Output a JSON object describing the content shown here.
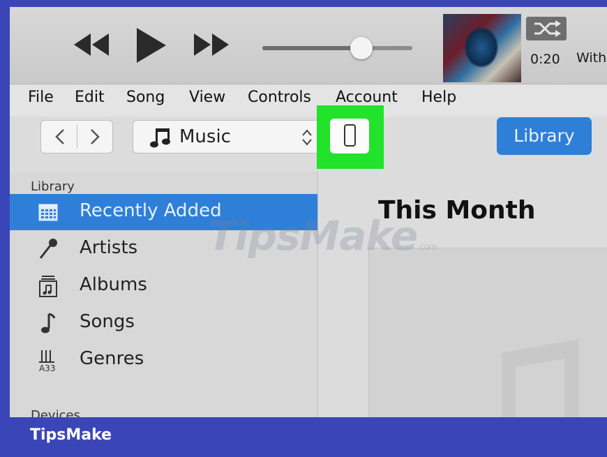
{
  "player": {
    "elapsed_time": "0:20",
    "now_playing": "With",
    "volume_level": 0.65
  },
  "menu": [
    "File",
    "Edit",
    "Song",
    "View",
    "Controls",
    "Account",
    "Help"
  ],
  "toolbar": {
    "back_icon": "chevron-left-icon",
    "forward_icon": "chevron-right-icon",
    "media_type": "Music",
    "device_icon": "iphone-icon",
    "library_label": "Library"
  },
  "sidebar": {
    "library_heading": "Library",
    "items": [
      {
        "label": "Recently Added",
        "icon": "grid-icon",
        "selected": true
      },
      {
        "label": "Artists",
        "icon": "microphone-icon",
        "selected": false
      },
      {
        "label": "Albums",
        "icon": "album-icon",
        "selected": false
      },
      {
        "label": "Songs",
        "icon": "music-note-icon",
        "selected": false
      },
      {
        "label": "Genres",
        "icon": "guitar-icon",
        "selected": false
      }
    ],
    "devices_heading": "Devices"
  },
  "content": {
    "title": "This Month"
  },
  "watermark": {
    "text": "TipsMake",
    "suffix": ".com"
  },
  "brand": "TipsMake",
  "colors": {
    "accent": "#2f7fd8",
    "highlight": "#21e32a",
    "frame": "#3a46b8"
  }
}
